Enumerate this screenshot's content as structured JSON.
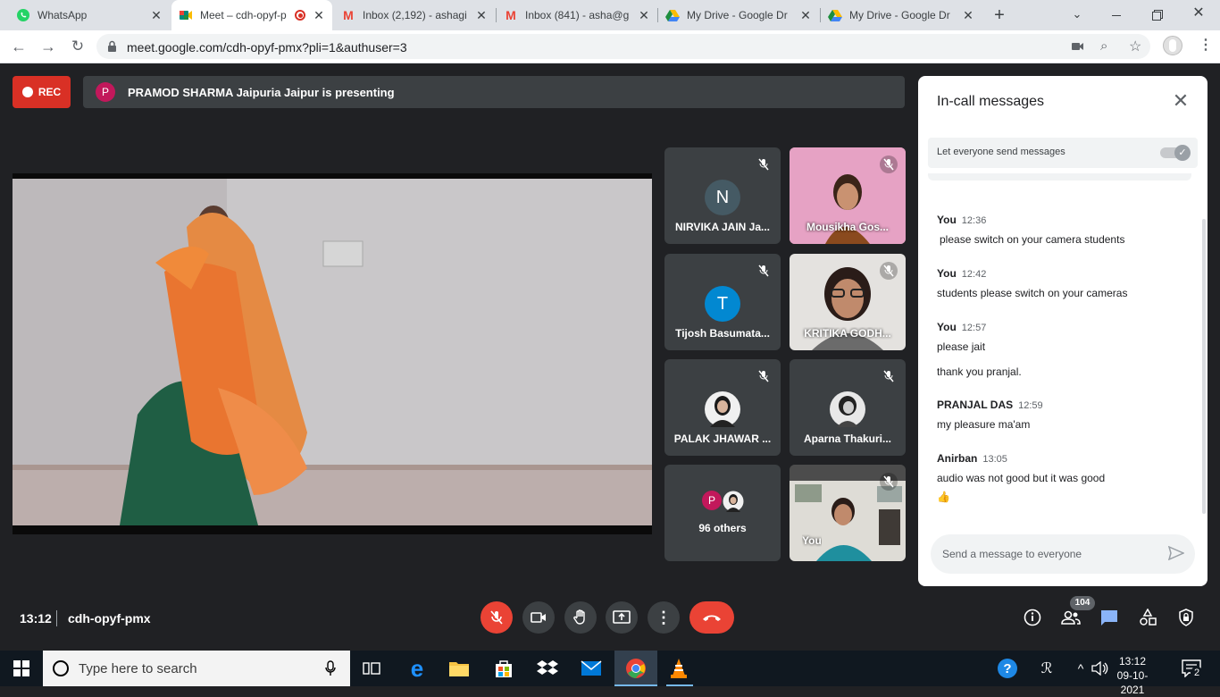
{
  "browser": {
    "tabs": [
      {
        "title": "WhatsApp",
        "icon": "whatsapp-icon",
        "color": "#25d366"
      },
      {
        "title": "Meet – cdh-opyf-p",
        "icon": "meet-icon",
        "color": "#00897b"
      },
      {
        "title": "Inbox (2,192) - ashagi",
        "icon": "gmail-icon",
        "color": "#ea4335"
      },
      {
        "title": "Inbox (841) - asha@g",
        "icon": "gmail-icon",
        "color": "#ea4335"
      },
      {
        "title": "My Drive - Google Dr",
        "icon": "drive-icon",
        "color": "#fbbc04"
      },
      {
        "title": "My Drive - Google Dr",
        "icon": "drive-icon",
        "color": "#fbbc04"
      }
    ],
    "url": "meet.google.com/cdh-opyf-pmx?pli=1&authuser=3"
  },
  "meet": {
    "rec_label": "REC",
    "presenter_initial": "P",
    "presenting_text": "PRAMOD SHARMA Jaipuria Jaipur is presenting",
    "tiles": [
      {
        "name": "NIRVIKA JAIN Ja...",
        "initial": "N",
        "avatar_color": "#455a64"
      },
      {
        "name": "Mousikha Gos...",
        "initial": "",
        "avatar_color": ""
      },
      {
        "name": "Tijosh Basumata...",
        "initial": "T",
        "avatar_color": "#0288d1"
      },
      {
        "name": "KRITIKA GODH...",
        "initial": "",
        "avatar_color": ""
      },
      {
        "name": "PALAK JHAWAR ...",
        "initial": "",
        "avatar_color": ""
      },
      {
        "name": "Aparna Thakuri...",
        "initial": "",
        "avatar_color": ""
      },
      {
        "name": "96 others",
        "initial": "P",
        "avatar_color": "#c2185b"
      },
      {
        "name": "You",
        "initial": "",
        "avatar_color": ""
      }
    ],
    "time": "13:12",
    "meeting_code": "cdh-opyf-pmx",
    "participant_count": "104",
    "end_call_color": "#ea4335"
  },
  "chat": {
    "title": "In-call messages",
    "let_everyone_label": "Let everyone send messages",
    "messages": [
      {
        "sender": "You",
        "time": "12:36",
        "text": "please switch on your camera students"
      },
      {
        "sender": "You",
        "time": "12:42",
        "text": "students please switch on your cameras"
      },
      {
        "sender": "You",
        "time": "12:57",
        "text": "please jait"
      },
      {
        "sender": "",
        "time": "",
        "text": "thank you pranjal."
      },
      {
        "sender": "PRANJAL DAS",
        "time": "12:59",
        "text": "my pleasure ma'am"
      },
      {
        "sender": "Anirban",
        "time": "13:05",
        "text": "audio was not good but it was good"
      },
      {
        "sender": "",
        "time": "",
        "text": "👍"
      }
    ],
    "send_placeholder": "Send a message to everyone"
  },
  "taskbar": {
    "search_placeholder": "Type here to search",
    "clock_time": "13:12",
    "clock_date": "09-10-2021",
    "notification_count": "2"
  }
}
